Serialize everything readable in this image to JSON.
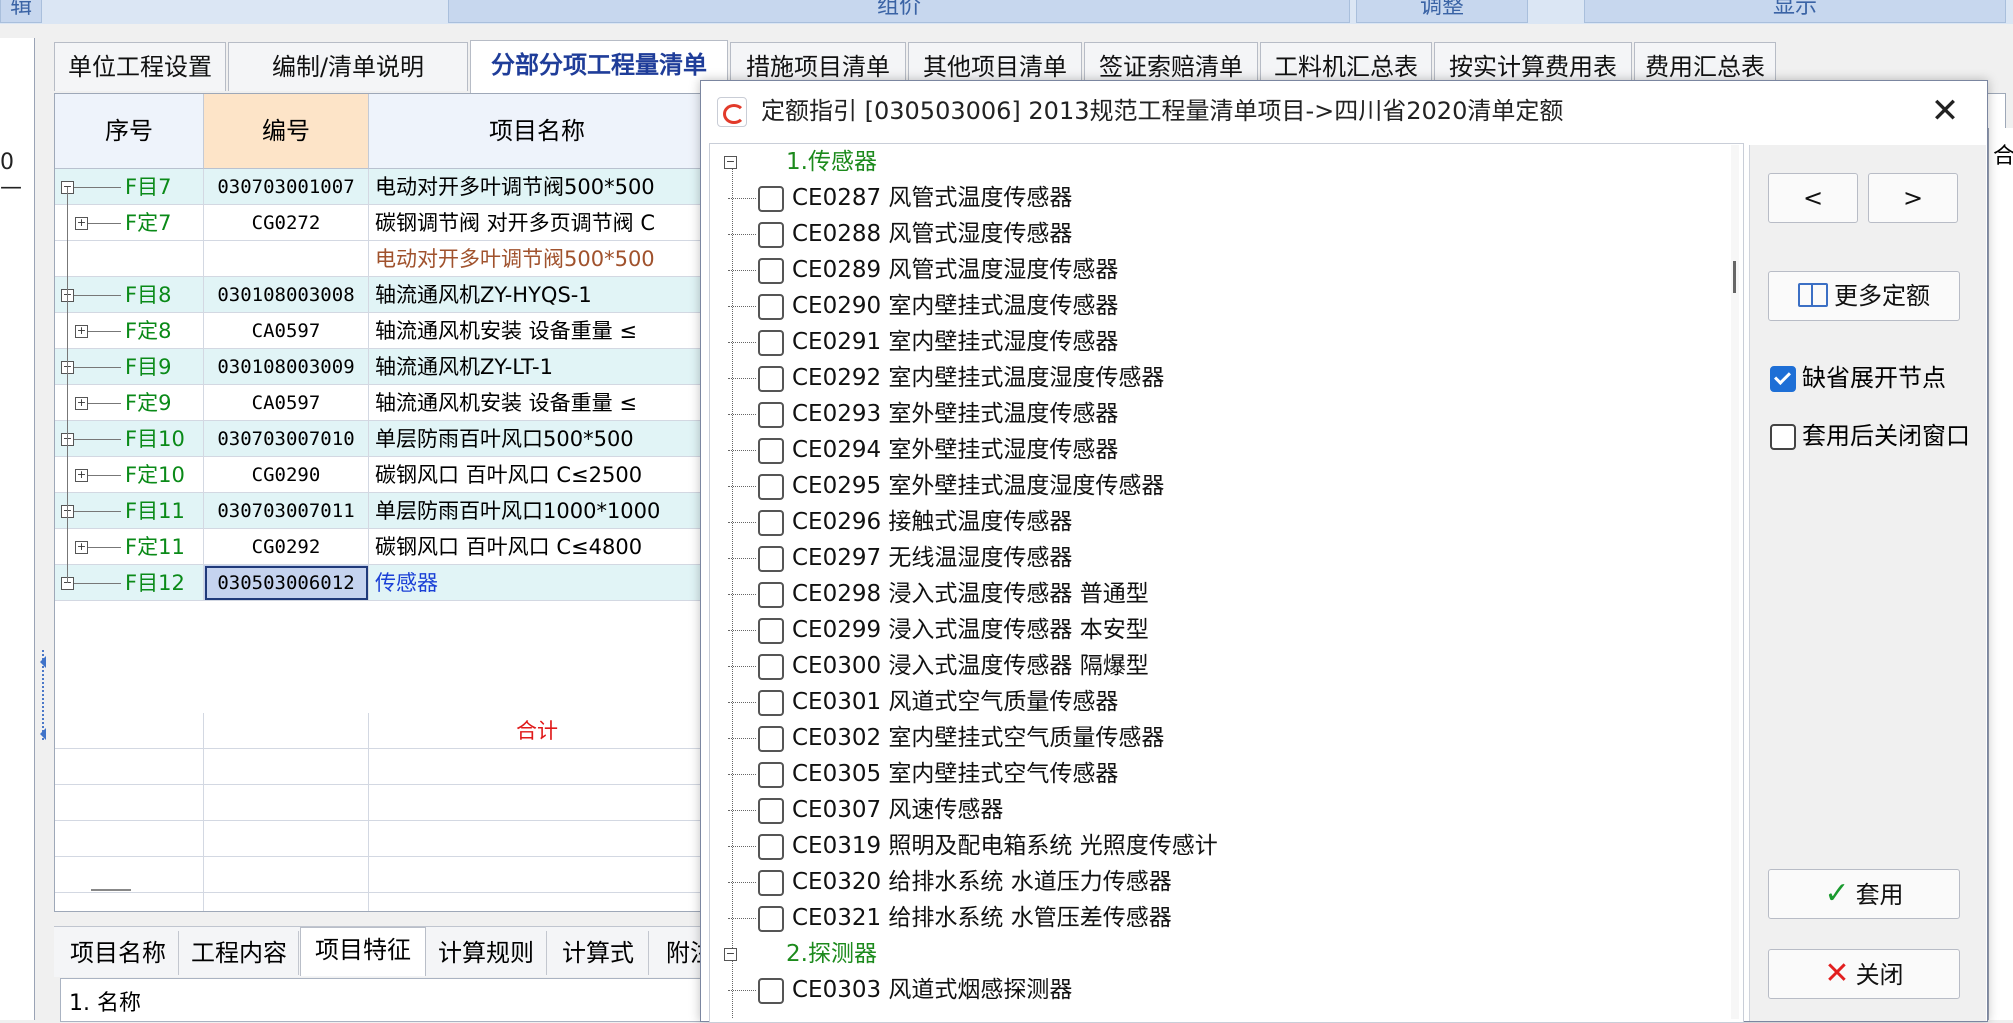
{
  "top_bar": {
    "btn1": "辑",
    "btn2": "组价",
    "btn3": "调整",
    "btn4": "显示"
  },
  "left_fragment": "0—",
  "tabs": [
    {
      "label": "单位工程设置"
    },
    {
      "label": "编制/清单说明"
    },
    {
      "label": "分部分项工程量清单",
      "active": true
    },
    {
      "label": "措施项目清单"
    },
    {
      "label": "其他项目清单"
    },
    {
      "label": "签证索赔清单"
    },
    {
      "label": "工料机汇总表"
    },
    {
      "label": "按实计算费用表"
    },
    {
      "label": "费用汇总表"
    }
  ],
  "grid": {
    "headers": {
      "seq": "序号",
      "code": "编号",
      "name": "项目名称"
    },
    "rows": [
      {
        "seq": "F目7",
        "code": "030703001007",
        "name": "电动对开多叶调节阀500*500",
        "type": "item"
      },
      {
        "seq": "F定7",
        "code": "CG0272",
        "name": "碳钢调节阀 对开多页调节阀 C",
        "type": "quota"
      },
      {
        "seq": "",
        "code": "",
        "name": "电动对开多叶调节阀500*500",
        "type": "sub",
        "color": "#a0522d"
      },
      {
        "seq": "F目8",
        "code": "030108003008",
        "name": "轴流通风机ZY-HYQS-1",
        "type": "item"
      },
      {
        "seq": "F定8",
        "code": "CA0597",
        "name": "轴流通风机安装 设备重量 ≤",
        "type": "quota"
      },
      {
        "seq": "F目9",
        "code": "030108003009",
        "name": "轴流通风机ZY-LT-1",
        "type": "item"
      },
      {
        "seq": "F定9",
        "code": "CA0597",
        "name": "轴流通风机安装 设备重量 ≤",
        "type": "quota"
      },
      {
        "seq": "F目10",
        "code": "030703007010",
        "name": "单层防雨百叶风口500*500",
        "type": "item"
      },
      {
        "seq": "F定10",
        "code": "CG0290",
        "name": "碳钢风口 百叶风口 C≤2500",
        "type": "quota"
      },
      {
        "seq": "F目11",
        "code": "030703007011",
        "name": "单层防雨百叶风口1000*1000",
        "type": "item"
      },
      {
        "seq": "F定11",
        "code": "CG0292",
        "name": "碳钢风口 百叶风口 C≤4800",
        "type": "quota"
      },
      {
        "seq": "F目12",
        "code": "030503006012",
        "name": "传感器",
        "type": "item",
        "selected": true,
        "color": "#1a3fd6"
      }
    ],
    "total_label": "合计"
  },
  "bottom_tabs": [
    {
      "label": "项目名称"
    },
    {
      "label": "工程内容"
    },
    {
      "label": "项目特征",
      "active": true
    },
    {
      "label": "计算规则"
    },
    {
      "label": "计算式"
    },
    {
      "label": "附注"
    }
  ],
  "bottom_text": "1. 名称",
  "dialog": {
    "title": "定额指引 [030503006] 2013规范工程量清单项目->四川省2020清单定额",
    "close_symbol": "✕",
    "tree": [
      {
        "kind": "group",
        "label": "1.传感器"
      },
      {
        "kind": "item",
        "label": "CE0287 风管式温度传感器"
      },
      {
        "kind": "item",
        "label": "CE0288 风管式湿度传感器"
      },
      {
        "kind": "item",
        "label": "CE0289 风管式温度湿度传感器"
      },
      {
        "kind": "item",
        "label": "CE0290 室内壁挂式温度传感器"
      },
      {
        "kind": "item",
        "label": "CE0291 室内壁挂式湿度传感器"
      },
      {
        "kind": "item",
        "label": "CE0292 室内壁挂式温度湿度传感器"
      },
      {
        "kind": "item",
        "label": "CE0293 室外壁挂式温度传感器"
      },
      {
        "kind": "item",
        "label": "CE0294 室外壁挂式湿度传感器"
      },
      {
        "kind": "item",
        "label": "CE0295 室外壁挂式温度湿度传感器"
      },
      {
        "kind": "item",
        "label": "CE0296 接触式温度传感器"
      },
      {
        "kind": "item",
        "label": "CE0297 无线温湿度传感器"
      },
      {
        "kind": "item",
        "label": "CE0298 浸入式温度传感器 普通型"
      },
      {
        "kind": "item",
        "label": "CE0299 浸入式温度传感器 本安型"
      },
      {
        "kind": "item",
        "label": "CE0300 浸入式温度传感器 隔爆型"
      },
      {
        "kind": "item",
        "label": "CE0301 风道式空气质量传感器"
      },
      {
        "kind": "item",
        "label": "CE0302 室内壁挂式空气质量传感器"
      },
      {
        "kind": "item",
        "label": "CE0305 室内壁挂式空气传感器"
      },
      {
        "kind": "item",
        "label": "CE0307 风速传感器"
      },
      {
        "kind": "item",
        "label": "CE0319  照明及配电箱系统 光照度传感计"
      },
      {
        "kind": "item",
        "label": "CE0320  给排水系统 水道压力传感器"
      },
      {
        "kind": "item",
        "label": "CE0321  给排水系统 水管压差传感器"
      },
      {
        "kind": "group",
        "label": "2.探测器"
      },
      {
        "kind": "item",
        "label": "CE0303 风道式烟感探测器"
      }
    ],
    "side": {
      "prev_symbol": "<",
      "next_symbol": ">",
      "more_label": "更多定额",
      "expand_label": "缺省展开节点",
      "expand_checked": true,
      "close_after_label": "套用后关闭窗口",
      "close_after_checked": false,
      "apply_label": "套用",
      "close_label": "关闭"
    }
  },
  "right_peek": "合",
  "colors": {
    "accent": "#1f3d99",
    "green": "#0a8a18",
    "highlight": "#e1f4f6",
    "code_header": "#fde4c8"
  }
}
